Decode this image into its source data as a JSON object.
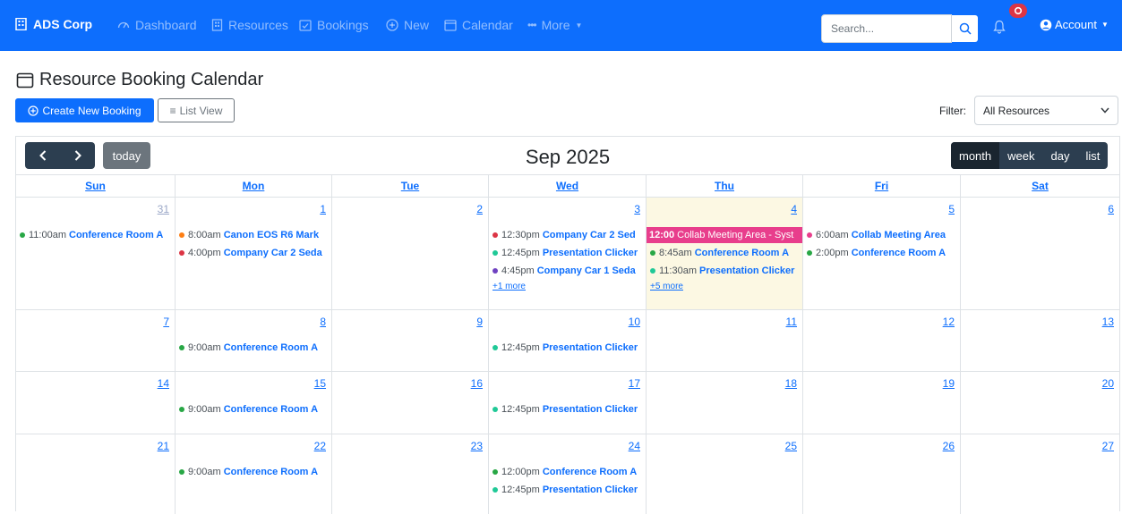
{
  "navbar": {
    "brand": "ADS Corp",
    "items": [
      {
        "label": "Dashboard",
        "icon": "dashboard-icon"
      },
      {
        "label": "Resources",
        "icon": "building-icon"
      },
      {
        "label": "Bookings",
        "icon": "calendar-check-icon"
      },
      {
        "label": "New",
        "icon": "plus-circle-icon"
      },
      {
        "label": "Calendar",
        "icon": "calendar-icon"
      },
      {
        "label": "More",
        "icon": "ellipsis-icon"
      }
    ],
    "search_placeholder": "Search...",
    "notification_badge_color": "#dc3545",
    "account_label": "Account"
  },
  "page": {
    "title": "Resource Booking Calendar",
    "create_button": "Create New Booking",
    "list_view_button": "List View",
    "filter_label": "Filter:",
    "filter_value": "All Resources"
  },
  "calendar": {
    "today_label": "today",
    "title": "Sep 2025",
    "views": [
      "month",
      "week",
      "day",
      "list"
    ],
    "active_view": "month",
    "weekdays": [
      "Sun",
      "Mon",
      "Tue",
      "Wed",
      "Thu",
      "Fri",
      "Sat"
    ],
    "weeks": [
      [
        {
          "num": "31",
          "other": true,
          "events": [
            {
              "time": "11:00am",
              "title": "Conference Room A",
              "color": "#28a745"
            }
          ]
        },
        {
          "num": "1",
          "events": [
            {
              "time": "8:00am",
              "title": "Canon EOS R6 Mark",
              "color": "#fd7e14"
            },
            {
              "time": "4:00pm",
              "title": "Company Car 2 Seda",
              "color": "#dc3545"
            }
          ]
        },
        {
          "num": "2",
          "events": []
        },
        {
          "num": "3",
          "events": [
            {
              "time": "12:30pm",
              "title": "Company Car 2 Sed",
              "color": "#dc3545"
            },
            {
              "time": "12:45pm",
              "title": "Presentation Clicker",
              "color": "#20c997"
            },
            {
              "time": "4:45pm",
              "title": "Company Car 1 Seda",
              "color": "#6f42c1"
            }
          ],
          "more": "+1 more"
        },
        {
          "num": "4",
          "today": true,
          "events": [
            {
              "time": "12:00",
              "title": "Collab Meeting Area - Syst",
              "block": true
            },
            {
              "time": "8:45am",
              "title": "Conference Room A",
              "color": "#28a745"
            },
            {
              "time": "11:30am",
              "title": "Presentation Clicker",
              "color": "#20c997"
            }
          ],
          "more": "+5 more"
        },
        {
          "num": "5",
          "events": [
            {
              "time": "6:00am",
              "title": "Collab Meeting Area",
              "color": "#e83e8c"
            },
            {
              "time": "2:00pm",
              "title": "Conference Room A",
              "color": "#28a745"
            }
          ]
        },
        {
          "num": "6",
          "events": []
        }
      ],
      [
        {
          "num": "7",
          "events": []
        },
        {
          "num": "8",
          "events": [
            {
              "time": "9:00am",
              "title": "Conference Room A",
              "color": "#28a745"
            }
          ]
        },
        {
          "num": "9",
          "events": []
        },
        {
          "num": "10",
          "events": [
            {
              "time": "12:45pm",
              "title": "Presentation Clicker",
              "color": "#20c997"
            }
          ]
        },
        {
          "num": "11",
          "events": []
        },
        {
          "num": "12",
          "events": []
        },
        {
          "num": "13",
          "events": []
        }
      ],
      [
        {
          "num": "14",
          "events": []
        },
        {
          "num": "15",
          "events": [
            {
              "time": "9:00am",
              "title": "Conference Room A",
              "color": "#28a745"
            }
          ]
        },
        {
          "num": "16",
          "events": []
        },
        {
          "num": "17",
          "events": [
            {
              "time": "12:45pm",
              "title": "Presentation Clicker",
              "color": "#20c997"
            }
          ]
        },
        {
          "num": "18",
          "events": []
        },
        {
          "num": "19",
          "events": []
        },
        {
          "num": "20",
          "events": []
        }
      ],
      [
        {
          "num": "21",
          "events": []
        },
        {
          "num": "22",
          "events": [
            {
              "time": "9:00am",
              "title": "Conference Room A",
              "color": "#28a745"
            }
          ]
        },
        {
          "num": "23",
          "events": []
        },
        {
          "num": "24",
          "events": [
            {
              "time": "12:00pm",
              "title": "Conference Room A",
              "color": "#28a745"
            },
            {
              "time": "12:45pm",
              "title": "Presentation Clicker",
              "color": "#20c997"
            }
          ]
        },
        {
          "num": "25",
          "events": []
        },
        {
          "num": "26",
          "events": []
        },
        {
          "num": "27",
          "events": []
        }
      ]
    ]
  }
}
